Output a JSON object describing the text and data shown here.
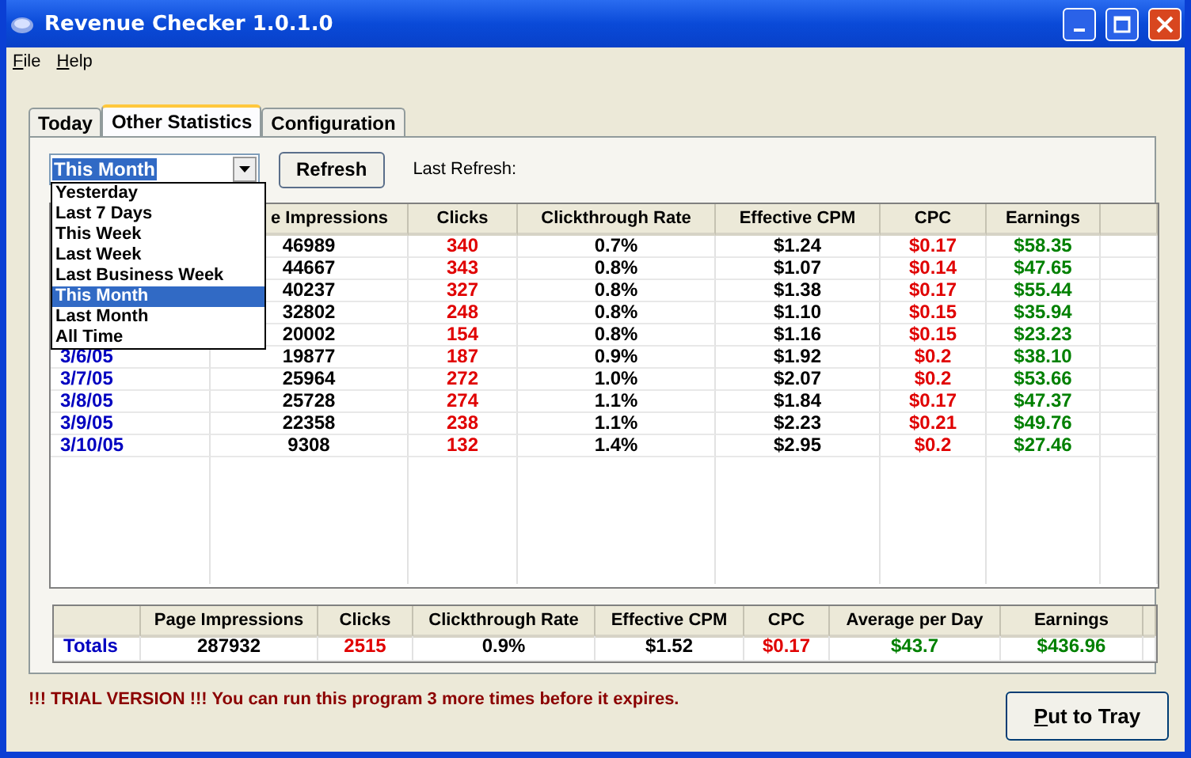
{
  "window": {
    "title": "Revenue Checker 1.0.1.0"
  },
  "menu": [
    "File",
    "Help"
  ],
  "tabs": [
    {
      "label": "Today",
      "selected": false
    },
    {
      "label": "Other Statistics",
      "selected": true
    },
    {
      "label": "Configuration",
      "selected": false
    }
  ],
  "period": {
    "value": "This Month",
    "options": [
      {
        "label": "Yesterday",
        "selected": false
      },
      {
        "label": "Last 7 Days",
        "selected": false
      },
      {
        "label": "This Week",
        "selected": false
      },
      {
        "label": "Last Week",
        "selected": false
      },
      {
        "label": "Last Business Week",
        "selected": false
      },
      {
        "label": "This Month",
        "selected": true
      },
      {
        "label": "Last Month",
        "selected": false
      },
      {
        "label": "All Time",
        "selected": false
      }
    ]
  },
  "refresh_button": "Refresh",
  "last_refresh_label": "Last Refresh:",
  "table": {
    "columns": [
      "e Impressions",
      "Clicks",
      "Clickthrough Rate",
      "Effective CPM",
      "CPC",
      "Earnings"
    ],
    "rows": [
      {
        "impressions": "46989",
        "clicks": "340",
        "rate": "0.7%",
        "cpm": "$1.24",
        "cpc": "$0.17",
        "earnings": "$58.35"
      },
      {
        "impressions": "44667",
        "clicks": "343",
        "rate": "0.8%",
        "cpm": "$1.07",
        "cpc": "$0.14",
        "earnings": "$47.65"
      },
      {
        "impressions": "40237",
        "clicks": "327",
        "rate": "0.8%",
        "cpm": "$1.38",
        "cpc": "$0.17",
        "earnings": "$55.44"
      },
      {
        "impressions": "32802",
        "clicks": "248",
        "rate": "0.8%",
        "cpm": "$1.10",
        "cpc": "$0.15",
        "earnings": "$35.94"
      },
      {
        "impressions": "20002",
        "clicks": "154",
        "rate": "0.8%",
        "cpm": "$1.16",
        "cpc": "$0.15",
        "earnings": "$23.23"
      },
      {
        "date": "3/6/05",
        "impressions": "19877",
        "clicks": "187",
        "rate": "0.9%",
        "cpm": "$1.92",
        "cpc": "$0.2",
        "earnings": "$38.10"
      },
      {
        "date": "3/7/05",
        "impressions": "25964",
        "clicks": "272",
        "rate": "1.0%",
        "cpm": "$2.07",
        "cpc": "$0.2",
        "earnings": "$53.66"
      },
      {
        "date": "3/8/05",
        "impressions": "25728",
        "clicks": "274",
        "rate": "1.1%",
        "cpm": "$1.84",
        "cpc": "$0.17",
        "earnings": "$47.37"
      },
      {
        "date": "3/9/05",
        "impressions": "22358",
        "clicks": "238",
        "rate": "1.1%",
        "cpm": "$2.23",
        "cpc": "$0.21",
        "earnings": "$49.76"
      },
      {
        "date": "3/10/05",
        "impressions": "9308",
        "clicks": "132",
        "rate": "1.4%",
        "cpm": "$2.95",
        "cpc": "$0.2",
        "earnings": "$27.46"
      }
    ]
  },
  "totals": {
    "columns": [
      "Page Impressions",
      "Clicks",
      "Clickthrough Rate",
      "Effective CPM",
      "CPC",
      "Average per Day",
      "Earnings"
    ],
    "row": {
      "label": "Totals",
      "impressions": "287932",
      "clicks": "2515",
      "rate": "0.9%",
      "cpm": "$1.52",
      "cpc": "$0.17",
      "average": "$43.7",
      "earnings": "$436.96"
    }
  },
  "trial_notice": "!!! TRIAL VERSION !!! You can run this program 3 more times before it expires.",
  "tray_button": "Put to Tray"
}
